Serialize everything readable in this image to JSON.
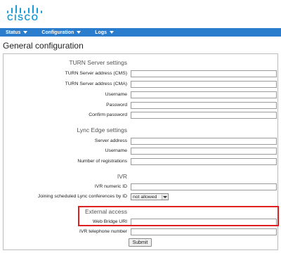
{
  "brand": {
    "logo_text": "CISCO",
    "color": "#1a9bd7"
  },
  "nav": {
    "background": "#2a7ccc",
    "items": [
      {
        "label": "Status"
      },
      {
        "label": "Configuration"
      },
      {
        "label": "Logs"
      }
    ]
  },
  "page": {
    "title": "General configuration"
  },
  "turn": {
    "title": "TURN Server settings",
    "server_address_cms": "TURN Server address (CMS)",
    "server_address_cma": "TURN Server address (CMA)",
    "username": "Username",
    "password": "Password",
    "confirm_password": "Confirm password"
  },
  "lync": {
    "title": "Lync Edge settings",
    "server_address": "Server address",
    "username": "Username",
    "num_registrations": "Number of registrations"
  },
  "ivr": {
    "title": "IVR",
    "numeric_id": "IVR numeric ID",
    "joining_label": "Joining scheduled Lync conferences by ID",
    "joining_value": "not allowed"
  },
  "external": {
    "title": "External access",
    "web_bridge_uri": "Web Bridge URI",
    "ivr_telephone": "IVR telephone number",
    "highlight_color": "#e02020"
  },
  "form": {
    "submit_label": "Submit"
  }
}
